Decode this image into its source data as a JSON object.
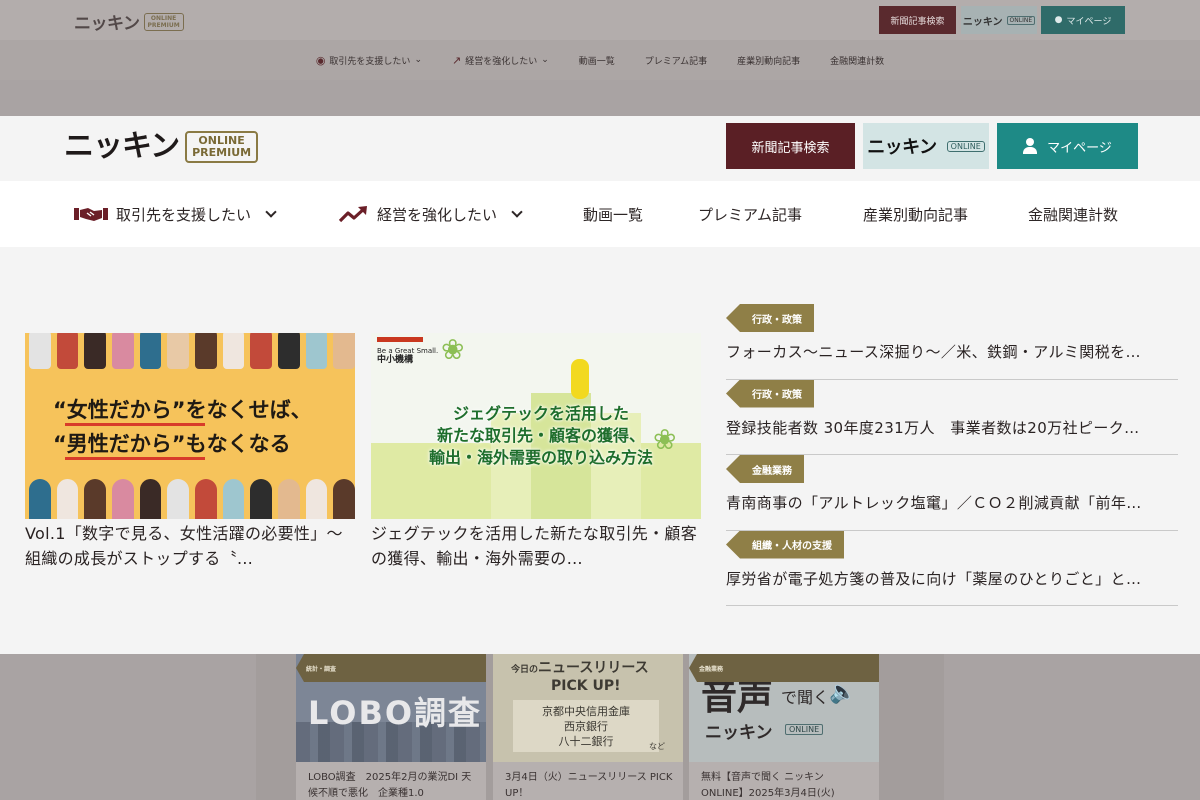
{
  "brand": {
    "wordmark": "ニッキン",
    "badge_line1": "ONLINE",
    "badge_line2": "PREMIUM"
  },
  "header": {
    "search_label": "新聞記事検索",
    "online_wordmark": "ニッキン",
    "online_badge": "ONLINE",
    "mypage_label": "マイページ"
  },
  "nav": {
    "items": [
      {
        "label": "取引先を支援したい",
        "icon": "handshake-icon",
        "dropdown": true
      },
      {
        "label": "経営を強化したい",
        "icon": "trend-up-icon",
        "dropdown": true
      },
      {
        "label": "動画一覧"
      },
      {
        "label": "プレミアム記事"
      },
      {
        "label": "産業別動向記事"
      },
      {
        "label": "金融関連計数"
      }
    ]
  },
  "featured": [
    {
      "image_text_line1": "“女性だから”をなくせば、",
      "image_text_line2": "“男性だから”もなくなる",
      "title": "Vol.1「数字で見る、女性活躍の必要性」～組織の成長がストップする〝…"
    },
    {
      "image_brand_small": "Be a Great Small.",
      "image_brand": "中小機構",
      "image_text_line1": "ジェグテックを活用した",
      "image_text_line2": "新たな取引先・顧客の獲得、",
      "image_text_line3": "輸出・海外需要の取り込み方法",
      "title": "ジェグテックを活用した新たな取引先・顧客の獲得、輸出・海外需要の…"
    }
  ],
  "news_list": [
    {
      "tag": "行政・政策",
      "title": "フォーカス～ニュース深掘り～／米、鉄鋼・アルミ関税を…"
    },
    {
      "tag": "行政・政策",
      "title": "登録技能者数 30年度231万人　事業者数は20万社ピーク…"
    },
    {
      "tag": "金融業務",
      "title": "青南商事の「アルトレック塩竃」／ＣＯ２削減貢献「前年…"
    },
    {
      "tag": "組織・人材の支援",
      "title": "厚労省が電子処方箋の普及に向け「薬屋のひとりごと」と…"
    }
  ],
  "background": {
    "search_label": "新聞記事検索",
    "online_wordmark": "ニッキン",
    "online_badge": "ONLINE",
    "mypage_label": "マイページ",
    "nav": [
      "取引先を支援したい",
      "経営を強化したい",
      "動画一覧",
      "プレミアム記事",
      "産業別動向記事",
      "金融関連計数"
    ],
    "cards": [
      {
        "tag": "統計・調査",
        "image_text": "LOBO調査",
        "caption": "LOBO調査　2025年2月の業況DI 天候不順で悪化　企業種1.0"
      },
      {
        "tag": "",
        "image_head1": "今日の",
        "image_head2": "ニュースリリース",
        "image_head3": "PICK UP!",
        "image_list1": "京都中央信用金庫",
        "image_list2": "西京銀行",
        "image_list3": "八十二銀行",
        "image_more": "など",
        "caption": "3月4日（火）ニュースリリース PICK UP！"
      },
      {
        "tag": "金融業務",
        "image_big": "音声",
        "image_de": "で聞く",
        "image_word": "ニッキン",
        "image_badge": "ONLINE",
        "caption": "無料【音声で聞く ニッキン ONLINE】2025年3月4日(火)"
      }
    ]
  },
  "colors": {
    "brand_dark_red": "#5a1f25",
    "brand_teal": "#1e8a86",
    "tag_gold": "#8f7f47",
    "online_light": "#d3e4e4"
  }
}
